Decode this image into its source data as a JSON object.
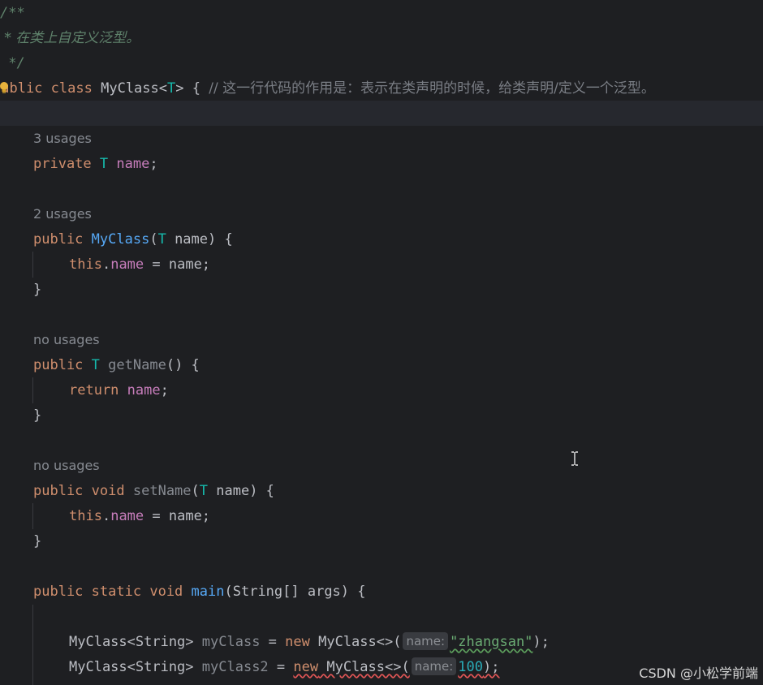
{
  "doc_comment": {
    "open": "/**",
    "body": " * 在类上自定义泛型。",
    "close": " */"
  },
  "class_decl": {
    "prefix": "public",
    "kw_class": "class",
    "name": "MyClass",
    "lt": "<",
    "type_param": "T",
    "gt": ">",
    "brace": " {",
    "comment": "// 这一行代码的作用是：表示在类声明的时候，给类声明/定义一个泛型。"
  },
  "field": {
    "hint": "3 usages",
    "modifier": "private",
    "type": "T",
    "name": "name",
    "end": ";"
  },
  "constructor": {
    "hint": "2 usages",
    "modifier": "public",
    "name": "MyClass",
    "params_open": "(",
    "param_type": "T",
    "param_name": " name) {",
    "body_this": "this",
    "body_dot": ".",
    "body_field": "name",
    "body_rest": " = name;",
    "close": "}"
  },
  "getter": {
    "hint": "no usages",
    "modifier": "public",
    "type": "T",
    "name": "getName",
    "sig_rest": "() {",
    "body_return": "return",
    "body_field": "name",
    "body_end": ";",
    "close": "}"
  },
  "setter": {
    "hint": "no usages",
    "modifier": "public",
    "kw_void": "void",
    "name": "setName",
    "params_open": "(",
    "param_type": "T",
    "param_name": " name) {",
    "body_this": "this",
    "body_dot": ".",
    "body_field": "name",
    "body_rest": " = name;",
    "close": "}"
  },
  "main": {
    "modifier": "public",
    "kw_static": "static",
    "kw_void": "void",
    "name": "main",
    "sig_rest": "(String[] args) {",
    "line1": {
      "type": "MyClass<String>",
      "var": "myClass",
      "eq": " = ",
      "kw_new": "new",
      "ctor": " MyClass<>(",
      "inlay": "name:",
      "arg": "\"zhangsan\"",
      "end": ");"
    },
    "line2": {
      "type": "MyClass<String>",
      "var": "myClass2",
      "eq": " = ",
      "kw_new": "new",
      "ctor": " MyClass<>(",
      "inlay": "name:",
      "arg": "100",
      "end": ");"
    }
  },
  "watermark": "CSDN @小松学前端",
  "icons": [
    "lightbulb-icon",
    "text-cursor-icon"
  ],
  "colors": {
    "background": "#1e1f22",
    "keyword": "#cf8e6d",
    "type_param": "#16baac",
    "field": "#c77dbb",
    "method": "#56a8f5",
    "string": "#6aab73",
    "number": "#2aacb8"
  }
}
